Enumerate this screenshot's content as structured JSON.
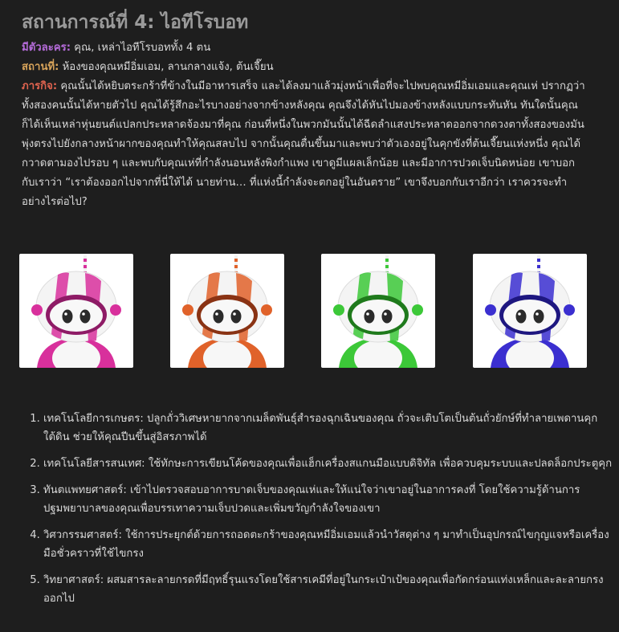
{
  "scenario": {
    "title": "สถานการณ์ที่ 4: ไอทีโรบอท",
    "characters_label": "มีตัวละคร:",
    "characters_value": " คุณ, เหล่าไอทีโรบอททั้ง 4 ตน",
    "place_label": "สถานที่:",
    "place_value": " ห้องของคุณหมีอิ่มเอม, ลานกลางแจ้ง, ต้นเจี๊ยน",
    "mission_label": "ภารกิจ:",
    "mission_value": " คุณนั้นได้หยิบตระกร้าที่ข้างในมีอาหารเสร็จ และได้ลงมาแล้วมุ่งหน้าเพื่อที่จะไปพบคุณหมีอิ่มเอมและคุณเห่ ปรากฏว่าทั้งสองคนนั้นได้หายตัวไป คุณได้รู้สึกอะไรบางอย่างจากข้างหลังคุณ คุณจึงได้หันไปมองข้างหลังแบบกระทันหัน ทันใดนั้นคุณก็ได้เห็นเหล่าหุ่นยนต์แปลกประหลาดจ้องมาที่คุณ ก่อนที่หนึ่งในพวกมันนั้นได้ฉีดลำแสงประหลาดออกจากดวงตาทั้งสองของมันพุ่งตรงไปยังกลางหน้าผากของคุณทำให้คุณสลบไป จากนั้นคุณตื่นขึ้นมาและพบว่าตัวเองอยู่ในคุกขังที่ต้นเจี๊ยนแห่งหนึ่ง คุณได้กวาดตามองไปรอบ ๆ และพบกับคุณเห่ที่กำลังนอนหลังพิงกำแพง เขาดูมีแผลเล็กน้อย และมีอาการปวดเจ็บนิดหน่อย เขาบอกกับเราว่า “เราต้องออกไปจากที่นี่ให้ได้ นายท่าน… ที่แห่งนี้กำลังจะตกอยู่ในอันตราย” เขาจึงบอกกับเราอีกว่า เราควรจะทำอย่างไรต่อไป?"
  },
  "robots": [
    {
      "color": "#d8309c",
      "dark": "#8e1b66",
      "eye": "pink-robot"
    },
    {
      "color": "#e0622a",
      "dark": "#8a3314",
      "eye": "orange-robot"
    },
    {
      "color": "#3cc838",
      "dark": "#1f7a1c",
      "eye": "green-robot"
    },
    {
      "color": "#3b2fd0",
      "dark": "#1e1780",
      "eye": "blue-robot"
    }
  ],
  "skills": [
    {
      "text": "เทคโนโลยีการเกษตร: ปลูกถั่ววิเศษหายากจากเมล็ดพันธุ์สำรองฉุกเฉินของคุณ ถั่วจะเติบโตเป็นต้นถั่วยักษ์ที่ทำลายเพดานคุกใต้ดิน ช่วยให้คุณปีนขึ้นสู่อิสรภาพได้"
    },
    {
      "text": "เทคโนโลยีสารสนเทศ: ใช้ทักษะการเขียนโค้ดของคุณเพื่อแฮ็กเครื่องสแกนมือแบบดิจิทัล เพื่อควบคุมระบบและปลดล็อกประตูคุก"
    },
    {
      "text": "ทันตแพทยศาสตร์: เข้าไปตรวจสอบอาการบาดเจ็บของคุณเห่และให้แน่ใจว่าเขาอยู่ในอาการคงที่ โดยใช้ความรู้ด้านการปฐมพยาบาลของคุณเพื่อบรรเทาความเจ็บปวดและเพิ่มขวัญกำลังใจของเขา"
    },
    {
      "text": "วิศวกรรมศาสตร์: ใช้การประยุกต์ด้วยการถอดตะกร้าของคุณหมีอิ่มเอมแล้วนำวัสดุต่าง ๆ มาทำเป็นอุปกรณ์ไขกุญแจหรือเครื่องมือชั่วคราวที่ใช้ไขกรง"
    },
    {
      "text": "วิทยาศาสตร์: ผสมสารละลายกรดที่มีฤทธิ์รุนแรงโดยใช้สารเคมีที่อยู่ในกระเป๋าเป้ของคุณเพื่อกัดกร่อนแท่งเหล็กและละลายกรงออกไป"
    }
  ]
}
